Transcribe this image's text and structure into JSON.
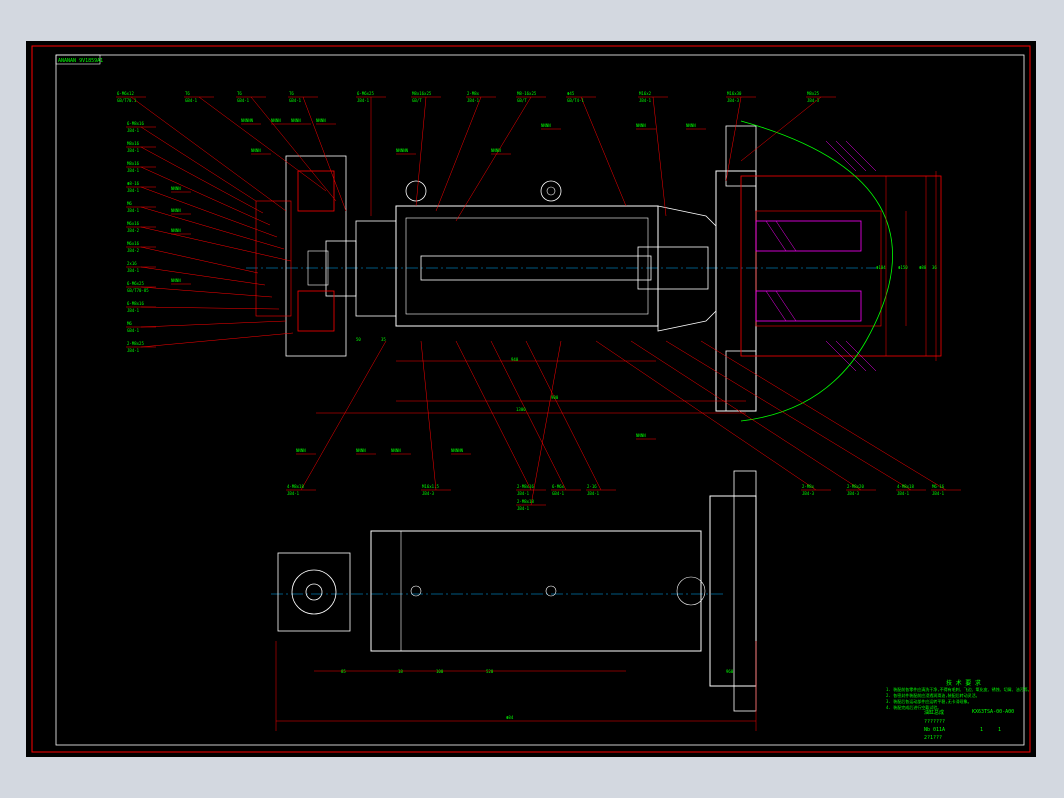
{
  "sheet": {
    "frame_tag": "ANANAN 9V1859A1"
  },
  "callouts_top": [
    {
      "top": "6-M6x12",
      "bot": "GB/T70.1"
    },
    {
      "top": "T6",
      "bot": "GB4-1"
    },
    {
      "top": "T6",
      "bot": "GB4-1"
    },
    {
      "top": "T6",
      "bot": "GB4-1"
    },
    {
      "top": "6-M6x25",
      "bot": "JB4-1"
    },
    {
      "top": "M8x16x25",
      "bot": "GB/T"
    },
    {
      "top": "2-M8x",
      "bot": "JB4-1"
    },
    {
      "top": "M8-16x25",
      "bot": "GB/T"
    },
    {
      "top": "Φ45",
      "bot": "GB/T4-1"
    },
    {
      "top": "M16x2",
      "bot": "JB4-1"
    },
    {
      "top": "M16x30",
      "bot": "JB4-3"
    },
    {
      "top": "M8x25",
      "bot": "JB4-3"
    }
  ],
  "callouts_left": [
    {
      "top": "6-M8x16",
      "bot": "JB4-1"
    },
    {
      "top": "M8x16",
      "bot": "JB4-1"
    },
    {
      "top": "M8x16",
      "bot": "JB4-1"
    },
    {
      "top": "Φ8-16",
      "bot": "JB4-1"
    },
    {
      "top": "M6",
      "bot": "JB4-1"
    },
    {
      "top": "M6x16",
      "bot": "JB4-2"
    },
    {
      "top": "M6x16",
      "bot": "JB4-2"
    },
    {
      "top": "2x16",
      "bot": "JB4-1"
    },
    {
      "top": "6-M6x25",
      "bot": "GB/T70-85"
    },
    {
      "top": "6-M8x16",
      "bot": "JB4-1"
    },
    {
      "top": "M6",
      "bot": "GB4-1"
    },
    {
      "top": "2-M8x25",
      "bot": "JB4-1"
    }
  ],
  "callouts_bottom": [
    {
      "top": "4-M8x18",
      "bot": "JB4-1"
    },
    {
      "top": "M16x1.5",
      "bot": "JB4-3"
    },
    {
      "top": "2-M8x16",
      "bot": "JB4-1"
    },
    {
      "top": "6-M6x",
      "bot": "GB4-1"
    },
    {
      "top": "2-16",
      "bot": "JB4-1"
    },
    {
      "top": "2-M8x18",
      "bot": "JB4-1"
    },
    {
      "top": "2-M8x",
      "bot": "JB4-3"
    },
    {
      "top": "2-M8x20",
      "bot": "JB4-3"
    },
    {
      "top": "4-M8x18",
      "bot": "JB4-1"
    },
    {
      "top": "M6-16",
      "bot": "JB4-1"
    }
  ],
  "tags": [
    "NNNNN",
    "NNNN",
    "NNNN",
    "NNNN",
    "NNNNN",
    "NNNN",
    "NNNN",
    "NNNN",
    "NNNN",
    "NNNN",
    "NNNN",
    "NNNN",
    "NNNN",
    "NNNN",
    "NNNN",
    "NNNN",
    "NNNN",
    "NNNNN",
    "NNNN"
  ],
  "dimensions": [
    "940",
    "900",
    "1300",
    "85",
    "18",
    "520",
    "Φ84",
    "Φ104",
    "Φ150",
    "Φ88",
    "36",
    "50",
    "35",
    "100",
    "960"
  ],
  "notes": {
    "heading": "技 术 要 求",
    "lines": [
      "1. 装配前各零件应清洗干净,不得有毛刺、飞边、氧化皮、锈蚀、切屑、油污等。",
      "2. 各密封件装配前应浸透润滑油,装配后转动灵活。",
      "3. 装配后各运动部件应运转平稳,无卡滞现象。",
      "4. 装配完成后进行空载试验。"
    ]
  },
  "title_block": {
    "code": "KX63TSA-00-A00",
    "row1_left": "油缸总成",
    "row2_left": "???????",
    "row3_left": "Nb 011A",
    "row3_mid": "1",
    "row3_right": "1",
    "row4_left": "2?1???"
  },
  "colors": {
    "outline": "#ffffff",
    "red": "#ff0000",
    "green": "#00ff00",
    "magenta": "#ff00ff",
    "cyan": "#00b0ff"
  }
}
